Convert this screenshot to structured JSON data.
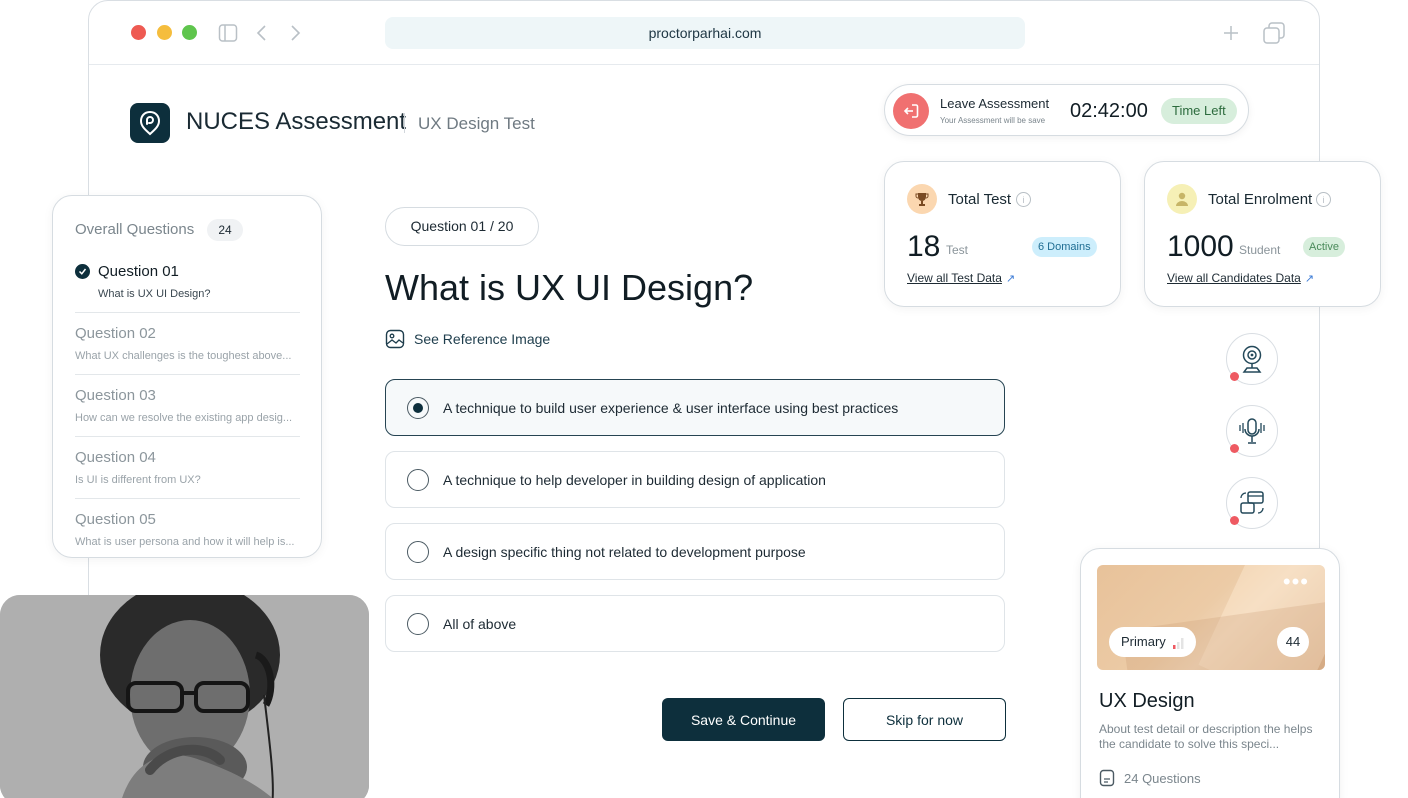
{
  "browser": {
    "url": "proctorparhai.com"
  },
  "header": {
    "brand": "NUCES Assessment",
    "subtitle": "UX Design Test"
  },
  "leave": {
    "title": "Leave Assessment",
    "subtitle": "Your Assessment will be save",
    "timer": "02:42:00",
    "time_left_label": "Time Left"
  },
  "stats": [
    {
      "title": "Total Test",
      "number": "18",
      "unit": "Test",
      "badge": "6 Domains",
      "link": "View all Test Data"
    },
    {
      "title": "Total Enrolment",
      "number": "1000",
      "unit": "Student",
      "badge": "Active",
      "link": "View all Candidates Data"
    }
  ],
  "questions_panel": {
    "title": "Overall Questions",
    "count": "24",
    "items": [
      {
        "label": "Question 01",
        "desc": "What is UX UI Design?"
      },
      {
        "label": "Question 02",
        "desc": "What UX challenges is the toughest above..."
      },
      {
        "label": "Question 03",
        "desc": "How can we resolve the existing app desig..."
      },
      {
        "label": "Question 04",
        "desc": "Is UI is different from UX?"
      },
      {
        "label": "Question 05",
        "desc": "What is user persona and how it will help is..."
      }
    ]
  },
  "question": {
    "counter": "Question 01 / 20",
    "title": "What is UX UI Design?",
    "reference_label": "See Reference Image",
    "options": [
      "A technique to build user experience & user interface using best practices",
      "A technique to help developer in building design of application",
      "A design specific thing not related to development purpose",
      "All of above"
    ],
    "selected_index": 0,
    "save_label": "Save & Continue",
    "skip_label": "Skip for now"
  },
  "course": {
    "tag": "Primary",
    "count": "44",
    "title": "UX Design",
    "desc": "About test detail or description the helps the candidate to solve this speci...",
    "questions": "24 Questions"
  },
  "colors": {
    "primary": "#0d2f3c",
    "record": "#ee5a62",
    "time_left_bg": "#d7eedc",
    "domains_bg": "#cdeefc",
    "active_bg": "#d7eedc"
  }
}
